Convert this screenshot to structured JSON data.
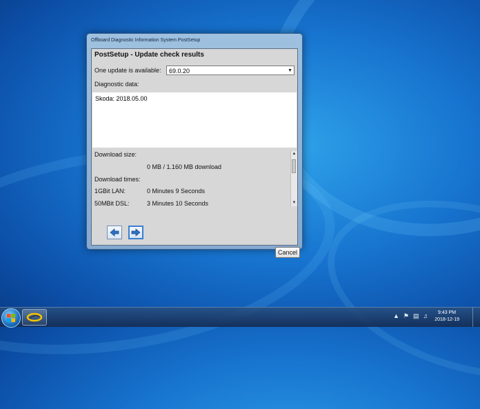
{
  "window": {
    "title": "Offboard Diagnostic Information System PostSetup",
    "heading": "PostSetup - Update check results",
    "update_label": "One update is available:",
    "update_version": "69.0.20",
    "diagnostic_label": "Diagnostic data:",
    "diagnostic_entries": [
      "Skoda: 2018.05.00"
    ],
    "download_size_label": "Download size:",
    "download_size_value": "0 MB / 1.160 MB download",
    "download_times_label": "Download times:",
    "times": [
      {
        "label": "1GBit LAN:",
        "value": "0 Minutes 9 Seconds"
      },
      {
        "label": "50MBit DSL:",
        "value": "3 Minutes 10 Seconds"
      }
    ],
    "cancel_label": "Cancel"
  },
  "taskbar": {
    "time": "9:43 PM",
    "date": "2018-12-19"
  },
  "icons": [
    "windows-start-icon",
    "app-swoosh-icon",
    "arrow-left-icon",
    "arrow-right-icon",
    "up-arrow-icon",
    "flag-icon",
    "network-icon",
    "volume-icon"
  ]
}
